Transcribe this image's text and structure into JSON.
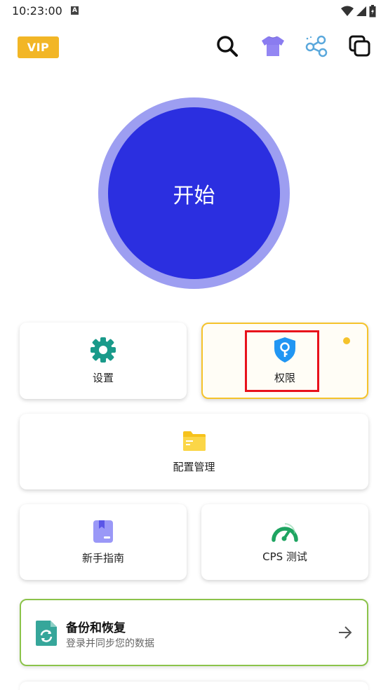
{
  "status_bar": {
    "time": "10:23:00",
    "a_badge": "A"
  },
  "header": {
    "vip_label": "VIP"
  },
  "start_button": {
    "label": "开始"
  },
  "cards": {
    "settings": {
      "label": "设置"
    },
    "permission": {
      "label": "权限"
    },
    "config": {
      "label": "配置管理"
    },
    "guide": {
      "label": "新手指南"
    },
    "cps": {
      "label": "CPS 测试"
    }
  },
  "backup": {
    "title": "备份和恢复",
    "subtitle": "登录并同步您的数据"
  },
  "colors": {
    "vip": "#f2b626",
    "start": "#2b2fe0",
    "start_ring": "#9d9ef1",
    "settings_icon": "#1a9a8a",
    "permission_icon": "#2196f3",
    "config_icon": "#f6c21c",
    "guide_icon": "#8c8cf5",
    "cps_icon": "#1ea461",
    "backup_border": "#8bc34a",
    "highlight": "#e8121c"
  }
}
